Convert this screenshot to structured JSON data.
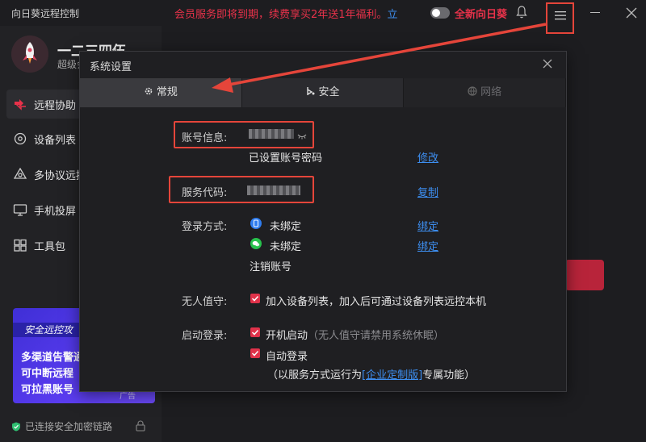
{
  "app": {
    "title": "向日葵远程控制",
    "promo_text": "会员服务即将到期，续费享买2年送1年福利。",
    "promo_link": "立",
    "new_sun_label": "全新向日葵"
  },
  "user": {
    "name": "一二三四伍...",
    "level": "超级会"
  },
  "sidebar": {
    "items": [
      {
        "label": "远程协助",
        "icon": "remote-assist-icon"
      },
      {
        "label": "设备列表",
        "icon": "device-list-icon"
      },
      {
        "label": "多协议远控",
        "icon": "multi-protocol-icon"
      },
      {
        "label": "手机投屏",
        "icon": "phone-cast-icon"
      },
      {
        "label": "工具包",
        "icon": "toolkit-icon"
      }
    ],
    "banner": {
      "tag": "安全远控攻",
      "line1": "多渠道告警通",
      "line2": "可中断远程",
      "line3": "可拉黑账号",
      "corner": "广告"
    },
    "status": "已连接安全加密链路"
  },
  "dialog": {
    "title": "系统设置",
    "tabs": [
      {
        "label": "常规",
        "icon": "gear-icon"
      },
      {
        "label": "安全",
        "icon": "security-icon"
      },
      {
        "label": "网络",
        "icon": "network-icon"
      }
    ],
    "account": {
      "label": "账号信息:",
      "password_status": "已设置账号密码",
      "modify_link": "修改"
    },
    "service": {
      "label": "服务代码:",
      "copy_link": "复制"
    },
    "login": {
      "label": "登录方式:",
      "phone_status": "未绑定",
      "phone_link": "绑定",
      "wechat_status": "未绑定",
      "wechat_link": "绑定",
      "deregister": "注销账号"
    },
    "unattended": {
      "label": "无人值守:",
      "option": "加入设备列表，加入后可通过设备列表远控本机"
    },
    "startup": {
      "label": "启动登录:",
      "boot_start": "开机启动",
      "boot_note": "（无人值守请禁用系统休眠）",
      "auto_login": "自动登录",
      "service_note_prefix": "（以服务方式运行为",
      "service_note_link": "[企业定制版]",
      "service_note_suffix": "专属功能）"
    }
  },
  "colors": {
    "accent_red": "#e8324a",
    "link_blue": "#3d8ef0",
    "highlight_box": "#e5453a",
    "banner_purple": "#4b36e3"
  }
}
